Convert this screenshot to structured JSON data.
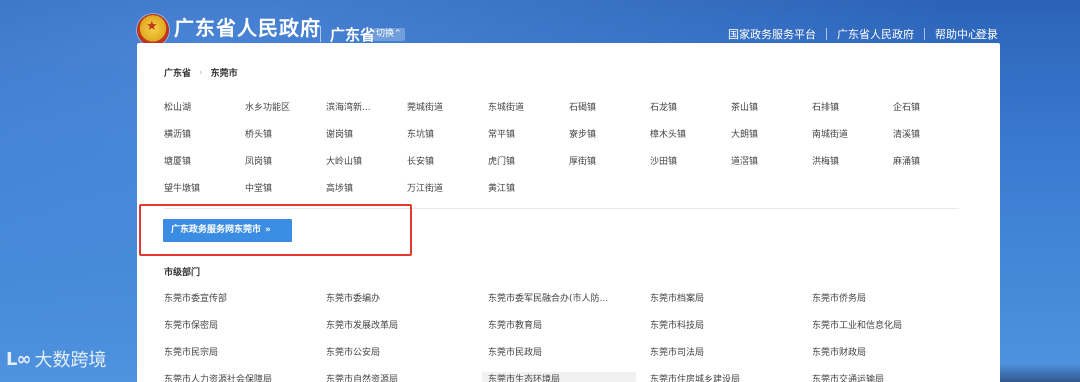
{
  "header": {
    "site_title": "广东省人民政府",
    "region": "广东省",
    "switch_label": "切换",
    "links": [
      "国家政务服务平台",
      "广东省人民政府",
      "帮助中心"
    ],
    "login": "登录"
  },
  "breadcrumb": {
    "province": "广东省",
    "city": "东莞市"
  },
  "towns": [
    "松山湖",
    "水乡功能区",
    "滨海湾新...",
    "莞城街道",
    "东城街道",
    "石碣镇",
    "石龙镇",
    "茶山镇",
    "石排镇",
    "企石镇",
    "横沥镇",
    "桥头镇",
    "谢岗镇",
    "东坑镇",
    "常平镇",
    "寮步镇",
    "樟木头镇",
    "大朗镇",
    "南城街道",
    "清溪镇",
    "塘厦镇",
    "凤岗镇",
    "大岭山镇",
    "长安镇",
    "虎门镇",
    "厚街镇",
    "沙田镇",
    "道滘镇",
    "洪梅镇",
    "麻涌镇",
    "望牛墩镇",
    "中堂镇",
    "高埗镇",
    "万江街道",
    "黄江镇"
  ],
  "gov_service_button": "广东政务服务网东莞市",
  "dept_section_title": "市级部门",
  "departments": [
    "东莞市委宣传部",
    "东莞市委编办",
    "东莞市委军民融合办(市人防...",
    "东莞市档案局",
    "东莞市侨务局",
    "东莞市保密局",
    "东莞市发展改革局",
    "东莞市教育局",
    "东莞市科技局",
    "东莞市工业和信息化局",
    "东莞市民宗局",
    "东莞市公安局",
    "东莞市民政局",
    "东莞市司法局",
    "东莞市财政局",
    "东莞市人力资源社会保障局",
    "东莞市自然资源局",
    "东莞市生态环境局",
    "东莞市住房城乡建设局",
    "东莞市交通运输局"
  ],
  "watermark": {
    "logo": "L∞",
    "text": "大数跨境"
  },
  "colors": {
    "accent": "#3b8de4",
    "highlight_box": "#e23a2e"
  }
}
